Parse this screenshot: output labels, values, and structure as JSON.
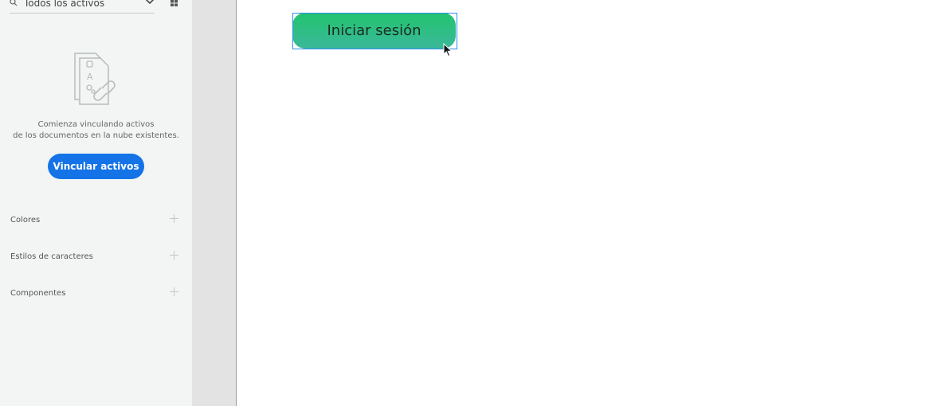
{
  "assets_panel": {
    "filter": {
      "value": "Todos los activos",
      "search_icon": "search-icon",
      "dropdown_icon": "chevron-down-icon"
    },
    "view_toggle_icon": "grid-icon",
    "empty_state": {
      "illustration_icon": "linked-documents-icon",
      "line1": "Comienza vinculando activos",
      "line2": "de los documentos en la nube existentes.",
      "button_label": "Vincular activos"
    },
    "sections": [
      {
        "label": "Colores",
        "icon": "add-icon"
      },
      {
        "label": "Estilos de caracteres",
        "icon": "add-icon"
      },
      {
        "label": "Componentes",
        "icon": "add-icon"
      }
    ]
  },
  "canvas": {
    "button_label": "Iniciar sesión",
    "cursor_icon": "mouse-pointer-icon"
  },
  "colors": {
    "accent": "#1473e6",
    "panel_background": "#f3f4f4",
    "pasteboard": "#e3e3e3",
    "button_gradient_top": "#22c46e",
    "button_gradient_bottom": "#3ab89a",
    "selection": "#2d8ceb"
  }
}
